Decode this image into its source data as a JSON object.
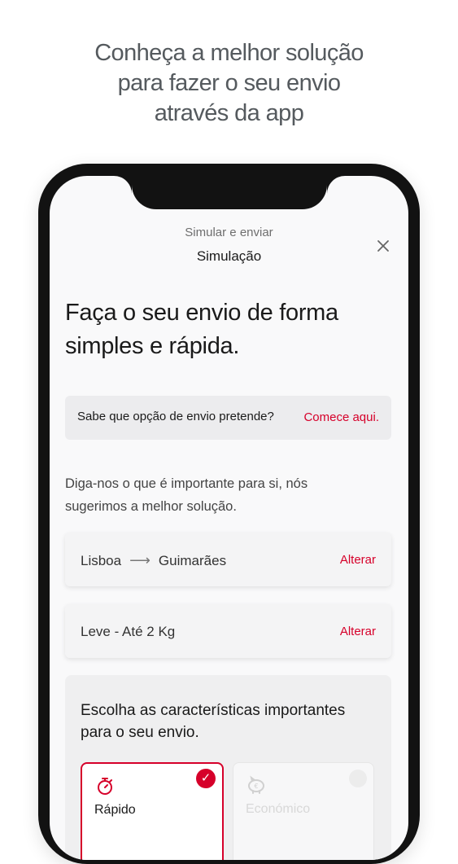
{
  "headline": {
    "line1": "Conheça a melhor solução",
    "line2": "para fazer o seu envio",
    "line3": "através da app"
  },
  "header": {
    "subtitle": "Simular e enviar",
    "title": "Simulação",
    "close_icon": "close-icon"
  },
  "hero": {
    "line1": "Faça o seu envio de forma",
    "line2": "simples e rápida."
  },
  "banner": {
    "question": "Sabe que opção de envio pretende?",
    "cta": "Comece aqui."
  },
  "intro": {
    "line1": "Diga-nos o que é importante para si, nós",
    "line2": "sugerimos a melhor solução."
  },
  "route": {
    "origin": "Lisboa",
    "destination": "Guimarães",
    "action": "Alterar"
  },
  "weight": {
    "value": "Leve - Até 2 Kg",
    "action": "Alterar"
  },
  "choose": {
    "heading_line1": "Escolha as características importantes",
    "heading_line2": "para o seu envio.",
    "options": [
      {
        "label": "Rápido",
        "icon": "stopwatch-icon",
        "selected": true
      },
      {
        "label": "Económico",
        "icon": "piggy-bank-icon",
        "selected": false
      }
    ]
  },
  "colors": {
    "accent": "#d6002a",
    "phone_frame": "#121212",
    "screen_bg": "#f9f9fa",
    "headline_text": "#555a5e"
  }
}
